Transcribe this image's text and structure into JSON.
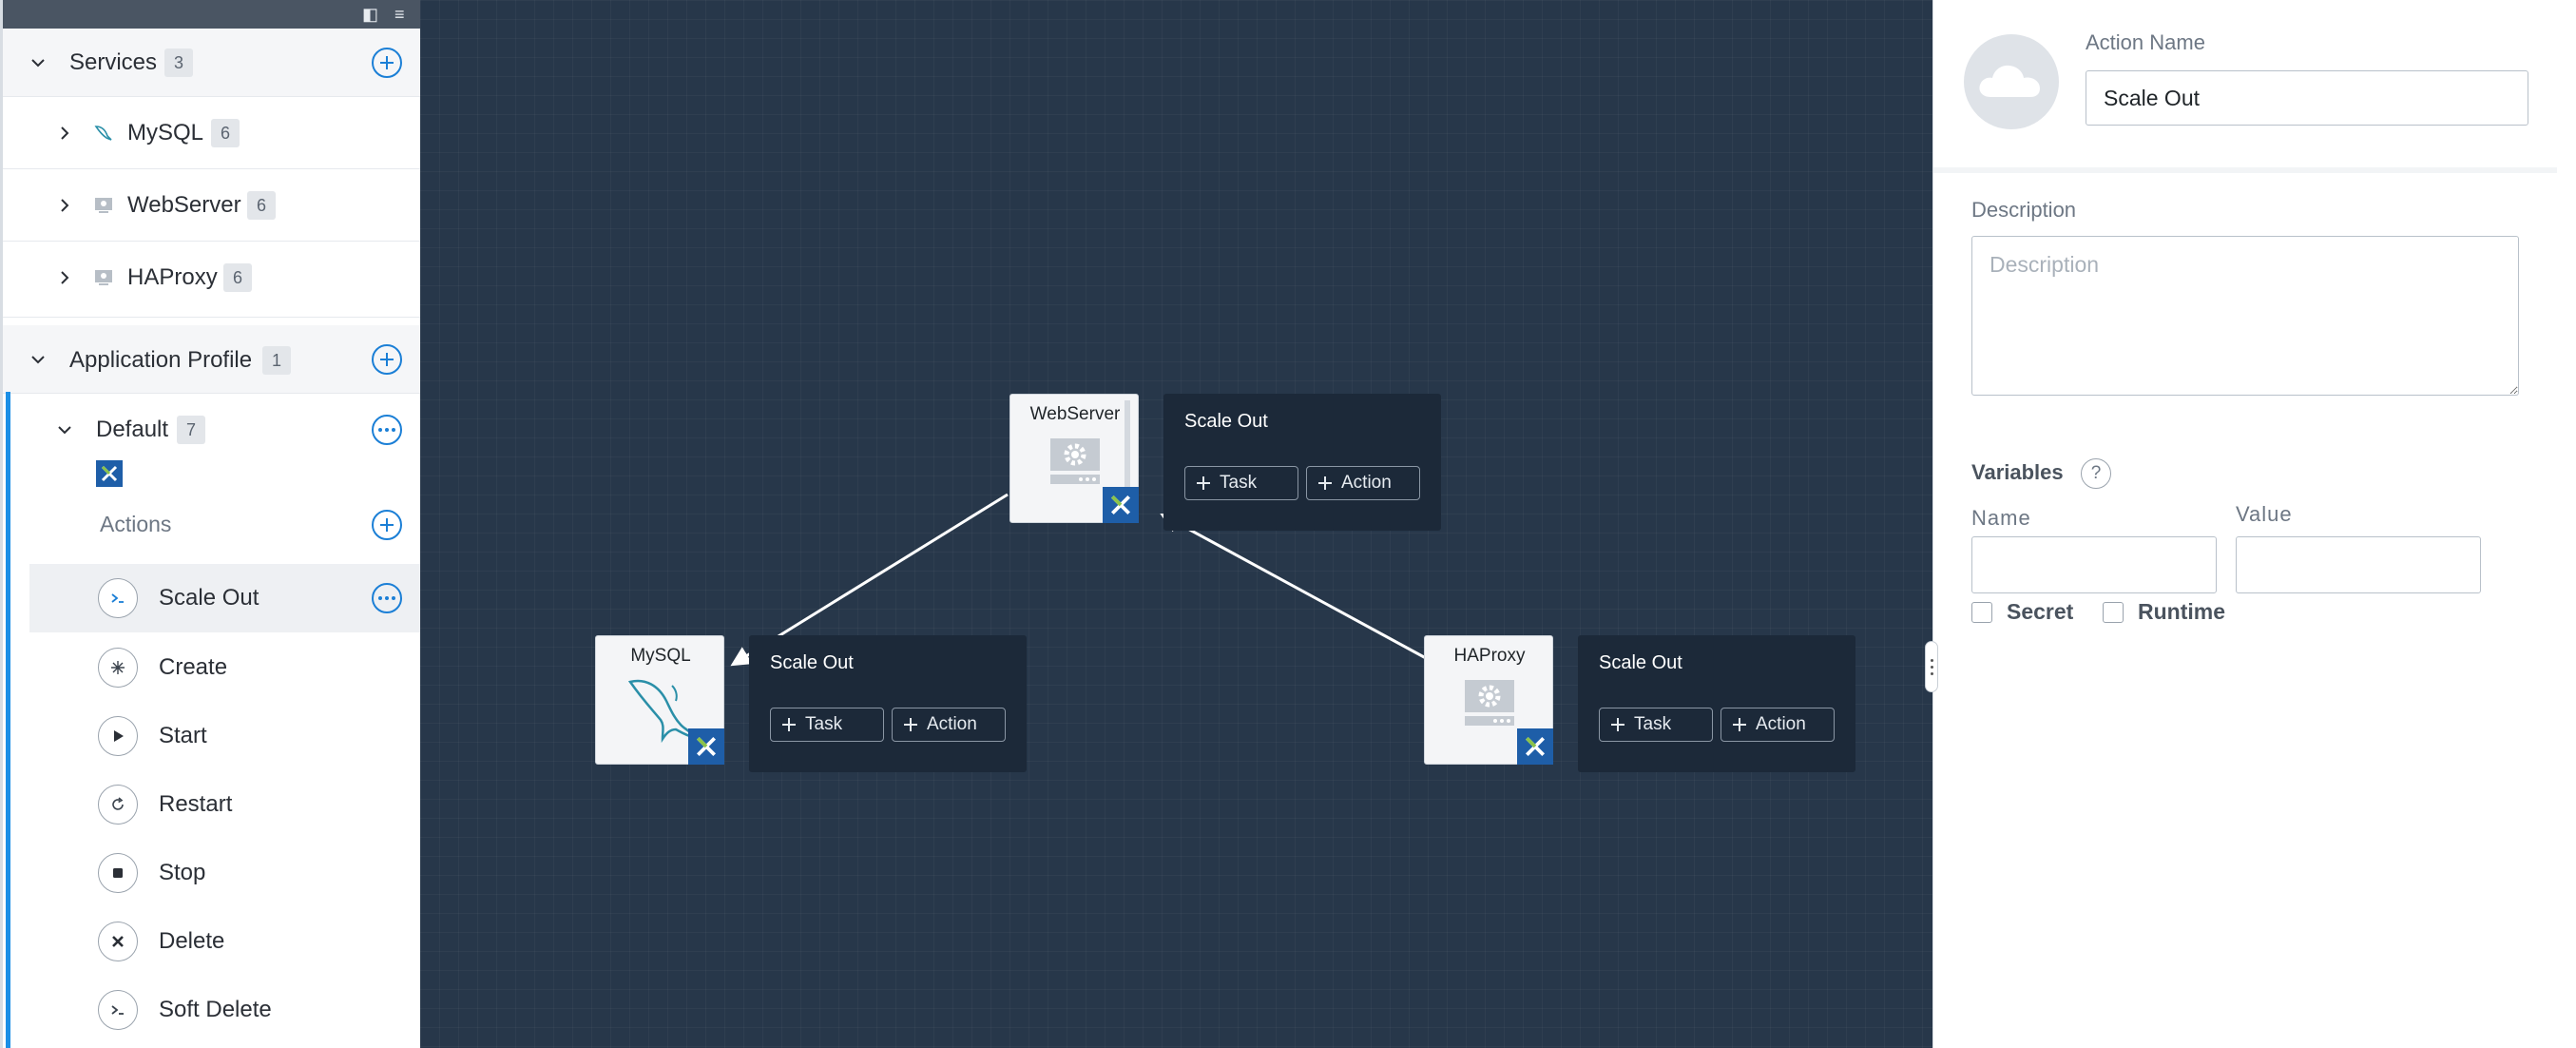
{
  "sidebar": {
    "services": {
      "label": "Services",
      "count": "3"
    },
    "service_items": [
      {
        "label": "MySQL",
        "count": "6"
      },
      {
        "label": "WebServer",
        "count": "6"
      },
      {
        "label": "HAProxy",
        "count": "6"
      }
    ],
    "app_profile": {
      "label": "Application Profile",
      "count": "1"
    },
    "default_profile": {
      "label": "Default",
      "count": "7"
    },
    "actions_header": "Actions",
    "actions": [
      {
        "label": "Scale Out",
        "icon": "terminal-icon"
      },
      {
        "label": "Create",
        "icon": "sparkle-icon"
      },
      {
        "label": "Start",
        "icon": "play-icon"
      },
      {
        "label": "Restart",
        "icon": "restart-icon"
      },
      {
        "label": "Stop",
        "icon": "stop-icon"
      },
      {
        "label": "Delete",
        "icon": "x-icon"
      },
      {
        "label": "Soft Delete",
        "icon": "terminal-icon"
      }
    ]
  },
  "canvas": {
    "nodes": {
      "webserver": {
        "title": "WebServer"
      },
      "mysql": {
        "title": "MySQL"
      },
      "haproxy": {
        "title": "HAProxy"
      }
    },
    "panels": {
      "webserver": {
        "title": "Scale Out",
        "task": "Task",
        "action": "Action"
      },
      "mysql": {
        "title": "Scale Out",
        "task": "Task",
        "action": "Action"
      },
      "haproxy": {
        "title": "Scale Out",
        "task": "Task",
        "action": "Action"
      }
    }
  },
  "right_panel": {
    "action_name_label": "Action Name",
    "action_name_value": "Scale Out",
    "description_label": "Description",
    "description_placeholder": "Description",
    "variables_label": "Variables",
    "help_glyph": "?",
    "name_label": "Name",
    "value_label": "Value",
    "secret_label": "Secret",
    "runtime_label": "Runtime"
  },
  "colors": {
    "accent": "#1b7fd6",
    "canvas": "#27374a",
    "nutanix_blue": "#1e5ea8"
  }
}
